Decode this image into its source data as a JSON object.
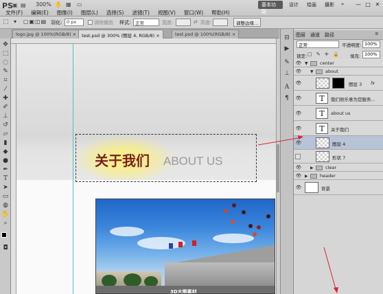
{
  "app": {
    "logo": "PS",
    "zoom": "300%"
  },
  "menu": [
    "文件(F)",
    "编辑(E)",
    "图像(I)",
    "图层(L)",
    "选择(S)",
    "滤镜(T)",
    "视图(V)",
    "窗口(W)",
    "帮助(H)"
  ],
  "workspace": {
    "active": "基本功能",
    "design": "设计",
    "paint": "绘画",
    "photo": "摄影",
    "more": "»"
  },
  "window_controls": [
    "—",
    "□",
    "✕"
  ],
  "options": {
    "feather_label": "羽化:",
    "feather_value": "0 px",
    "antialias": "消除锯齿",
    "style_label": "样式:",
    "style_value": "正常",
    "width_label": "宽度:",
    "height_label": "高度:",
    "refine": "调整边缘..."
  },
  "tabs": [
    "logo.jpg @ 100%(RGB/8) ×",
    "test.psd @ 300% (图层 4, RGB/8) ×",
    "test.psd @ 100%(RGB/8) ×"
  ],
  "canvas": {
    "title_zh": "关于我们",
    "title_en": "ABOUT US",
    "photo_caption": "3D大图素材"
  },
  "panel": {
    "tabs": [
      "图层",
      "通道",
      "路径"
    ],
    "blend_mode": "正常",
    "opacity_label": "不透明度:",
    "opacity": "100%",
    "lock_label": "锁定:",
    "lock_icons": "□ ✎ ✛ 🔒",
    "fill_label": "填充:",
    "fill": "100%"
  },
  "layers": [
    {
      "name": "center",
      "type": "group",
      "indent": 0,
      "open": true
    },
    {
      "name": "about",
      "type": "group",
      "indent": 1,
      "open": true
    },
    {
      "name": "图层 3",
      "type": "masked",
      "indent": 2,
      "fx": "fx"
    },
    {
      "name": "我们很乐意为您服务...",
      "type": "text",
      "indent": 2
    },
    {
      "name": "about us",
      "type": "text",
      "indent": 2
    },
    {
      "name": "关于我们",
      "type": "text",
      "indent": 2
    },
    {
      "name": "图层 4",
      "type": "pixel",
      "indent": 2,
      "selected": true
    },
    {
      "name": "形状 7",
      "type": "pixel",
      "indent": 2
    },
    {
      "name": "clear",
      "type": "group",
      "indent": 1,
      "open": false
    },
    {
      "name": "header",
      "type": "group",
      "indent": 0,
      "open": false
    },
    {
      "name": "背景",
      "type": "background",
      "indent": 0
    }
  ],
  "accent": {
    "annotation": "#d9232e",
    "selection_row": "#b7c3d6",
    "guide": "#3ec6d6"
  }
}
